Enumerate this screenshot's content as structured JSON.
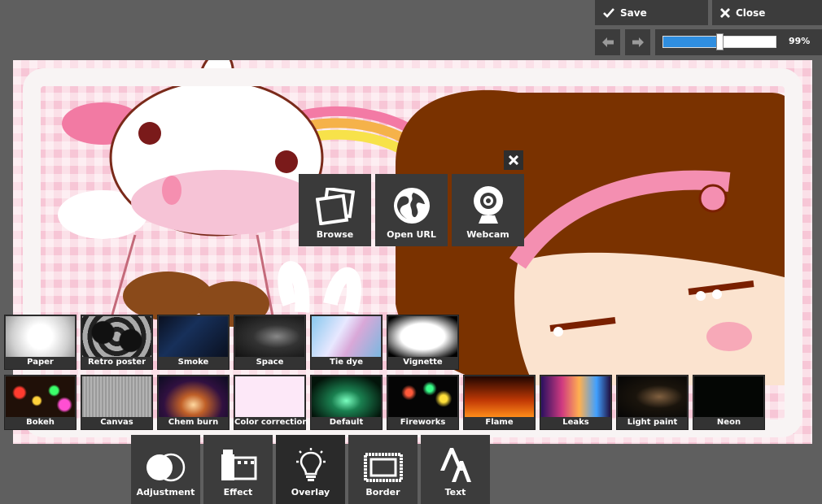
{
  "toolbar": {
    "save_label": "Save",
    "close_label": "Close",
    "zoom_value": "99%",
    "zoom_fraction": 0.99
  },
  "upload_dialog": {
    "browse_label": "Browse",
    "open_url_label": "Open URL",
    "webcam_label": "Webcam"
  },
  "overlays": {
    "row1": [
      "Paper",
      "Retro poster",
      "Smoke",
      "Space",
      "Tie dye",
      "Vignette"
    ],
    "row2": [
      "Bokeh",
      "Canvas",
      "Chem burn",
      "Color correction",
      "Default",
      "Fireworks",
      "Flame",
      "Leaks",
      "Light paint",
      "Neon"
    ]
  },
  "tools": {
    "adjustment_label": "Adjustment",
    "effect_label": "Effect",
    "overlay_label": "Overlay",
    "border_label": "Border",
    "text_label": "Text",
    "active": "Overlay"
  },
  "colors": {
    "accent": "#2f8ee0",
    "panel": "#3c3c3c",
    "background": "#5f5f5f"
  }
}
